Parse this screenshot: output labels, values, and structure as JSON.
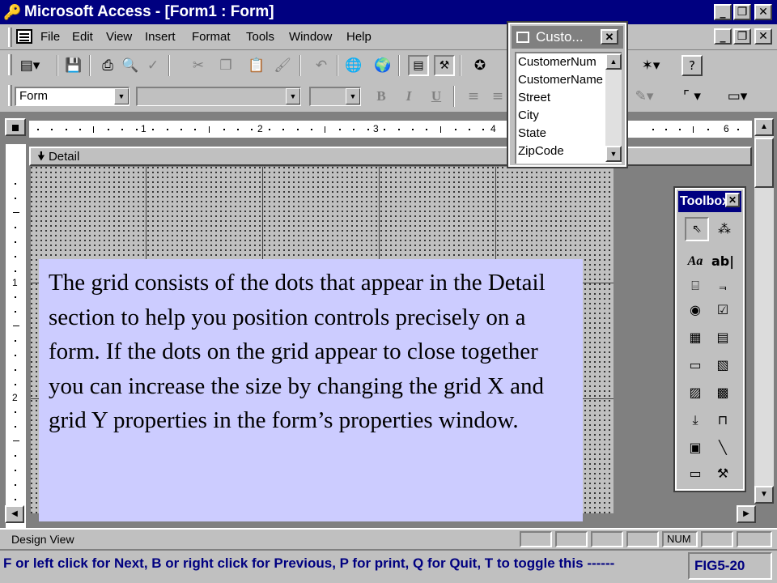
{
  "window": {
    "title": "Microsoft Access - [Form1 : Form]"
  },
  "title_controls": {
    "minimize": "_",
    "restore": "❐",
    "close": "✕"
  },
  "menu": [
    "File",
    "Edit",
    "View",
    "Insert",
    "Format",
    "Tools",
    "Window",
    "Help"
  ],
  "formatting": {
    "object_combo": "Form"
  },
  "ruler": {
    "horizontal": [
      "1",
      "2",
      "3",
      "4",
      "6"
    ],
    "vertical": [
      "1",
      "2"
    ]
  },
  "detail": {
    "section_label": "Detail"
  },
  "field_list": {
    "title": "Custo...",
    "fields": [
      "CustomerNum",
      "CustomerName",
      "Street",
      "City",
      "State",
      "ZipCode"
    ]
  },
  "toolbox": {
    "title": "Toolbox"
  },
  "note": "The grid consists of the dots that appear in the Detail section to help you position controls precisely on a form.  If the dots on the grid appear to close together you can increase the size by changing the grid X and grid Y properties in the form’s properties window.",
  "status": {
    "label": "Design View",
    "num_indicator": "NUM"
  },
  "instructions": {
    "text": "F or left click for Next, B or right click for Previous, P for print, Q for Quit, T to toggle this ------",
    "figure": "FIG5-20"
  },
  "colors": {
    "title_bar": "#000080",
    "field_list_title": "#808080",
    "note_bg": "#ccccff",
    "chrome": "#c0c0c0",
    "instructions_text": "#000080"
  },
  "icons": {
    "toolbar": [
      "form-view-icon",
      "save-icon",
      "print-icon",
      "print-preview-icon",
      "spelling-icon",
      "cut-icon",
      "copy-icon",
      "paste-icon",
      "format-painter-icon",
      "undo-icon",
      "hyperlink-icon",
      "web-toolbar-icon",
      "field-list-icon",
      "toolbox-icon",
      "autoformat-icon",
      "new-object-icon",
      "help-icon"
    ],
    "toolbox": [
      "select-objects-icon",
      "control-wizards-icon",
      "label-tool-icon",
      "textbox-tool-icon",
      "option-group-icon",
      "toggle-button-icon",
      "option-button-icon",
      "checkbox-icon",
      "combo-box-icon",
      "list-box-icon",
      "command-button-icon",
      "image-tool-icon",
      "unbound-object-frame-icon",
      "bound-object-frame-icon",
      "page-break-icon",
      "tab-control-icon",
      "subform-icon",
      "line-tool-icon",
      "rectangle-tool-icon",
      "more-controls-icon"
    ]
  }
}
